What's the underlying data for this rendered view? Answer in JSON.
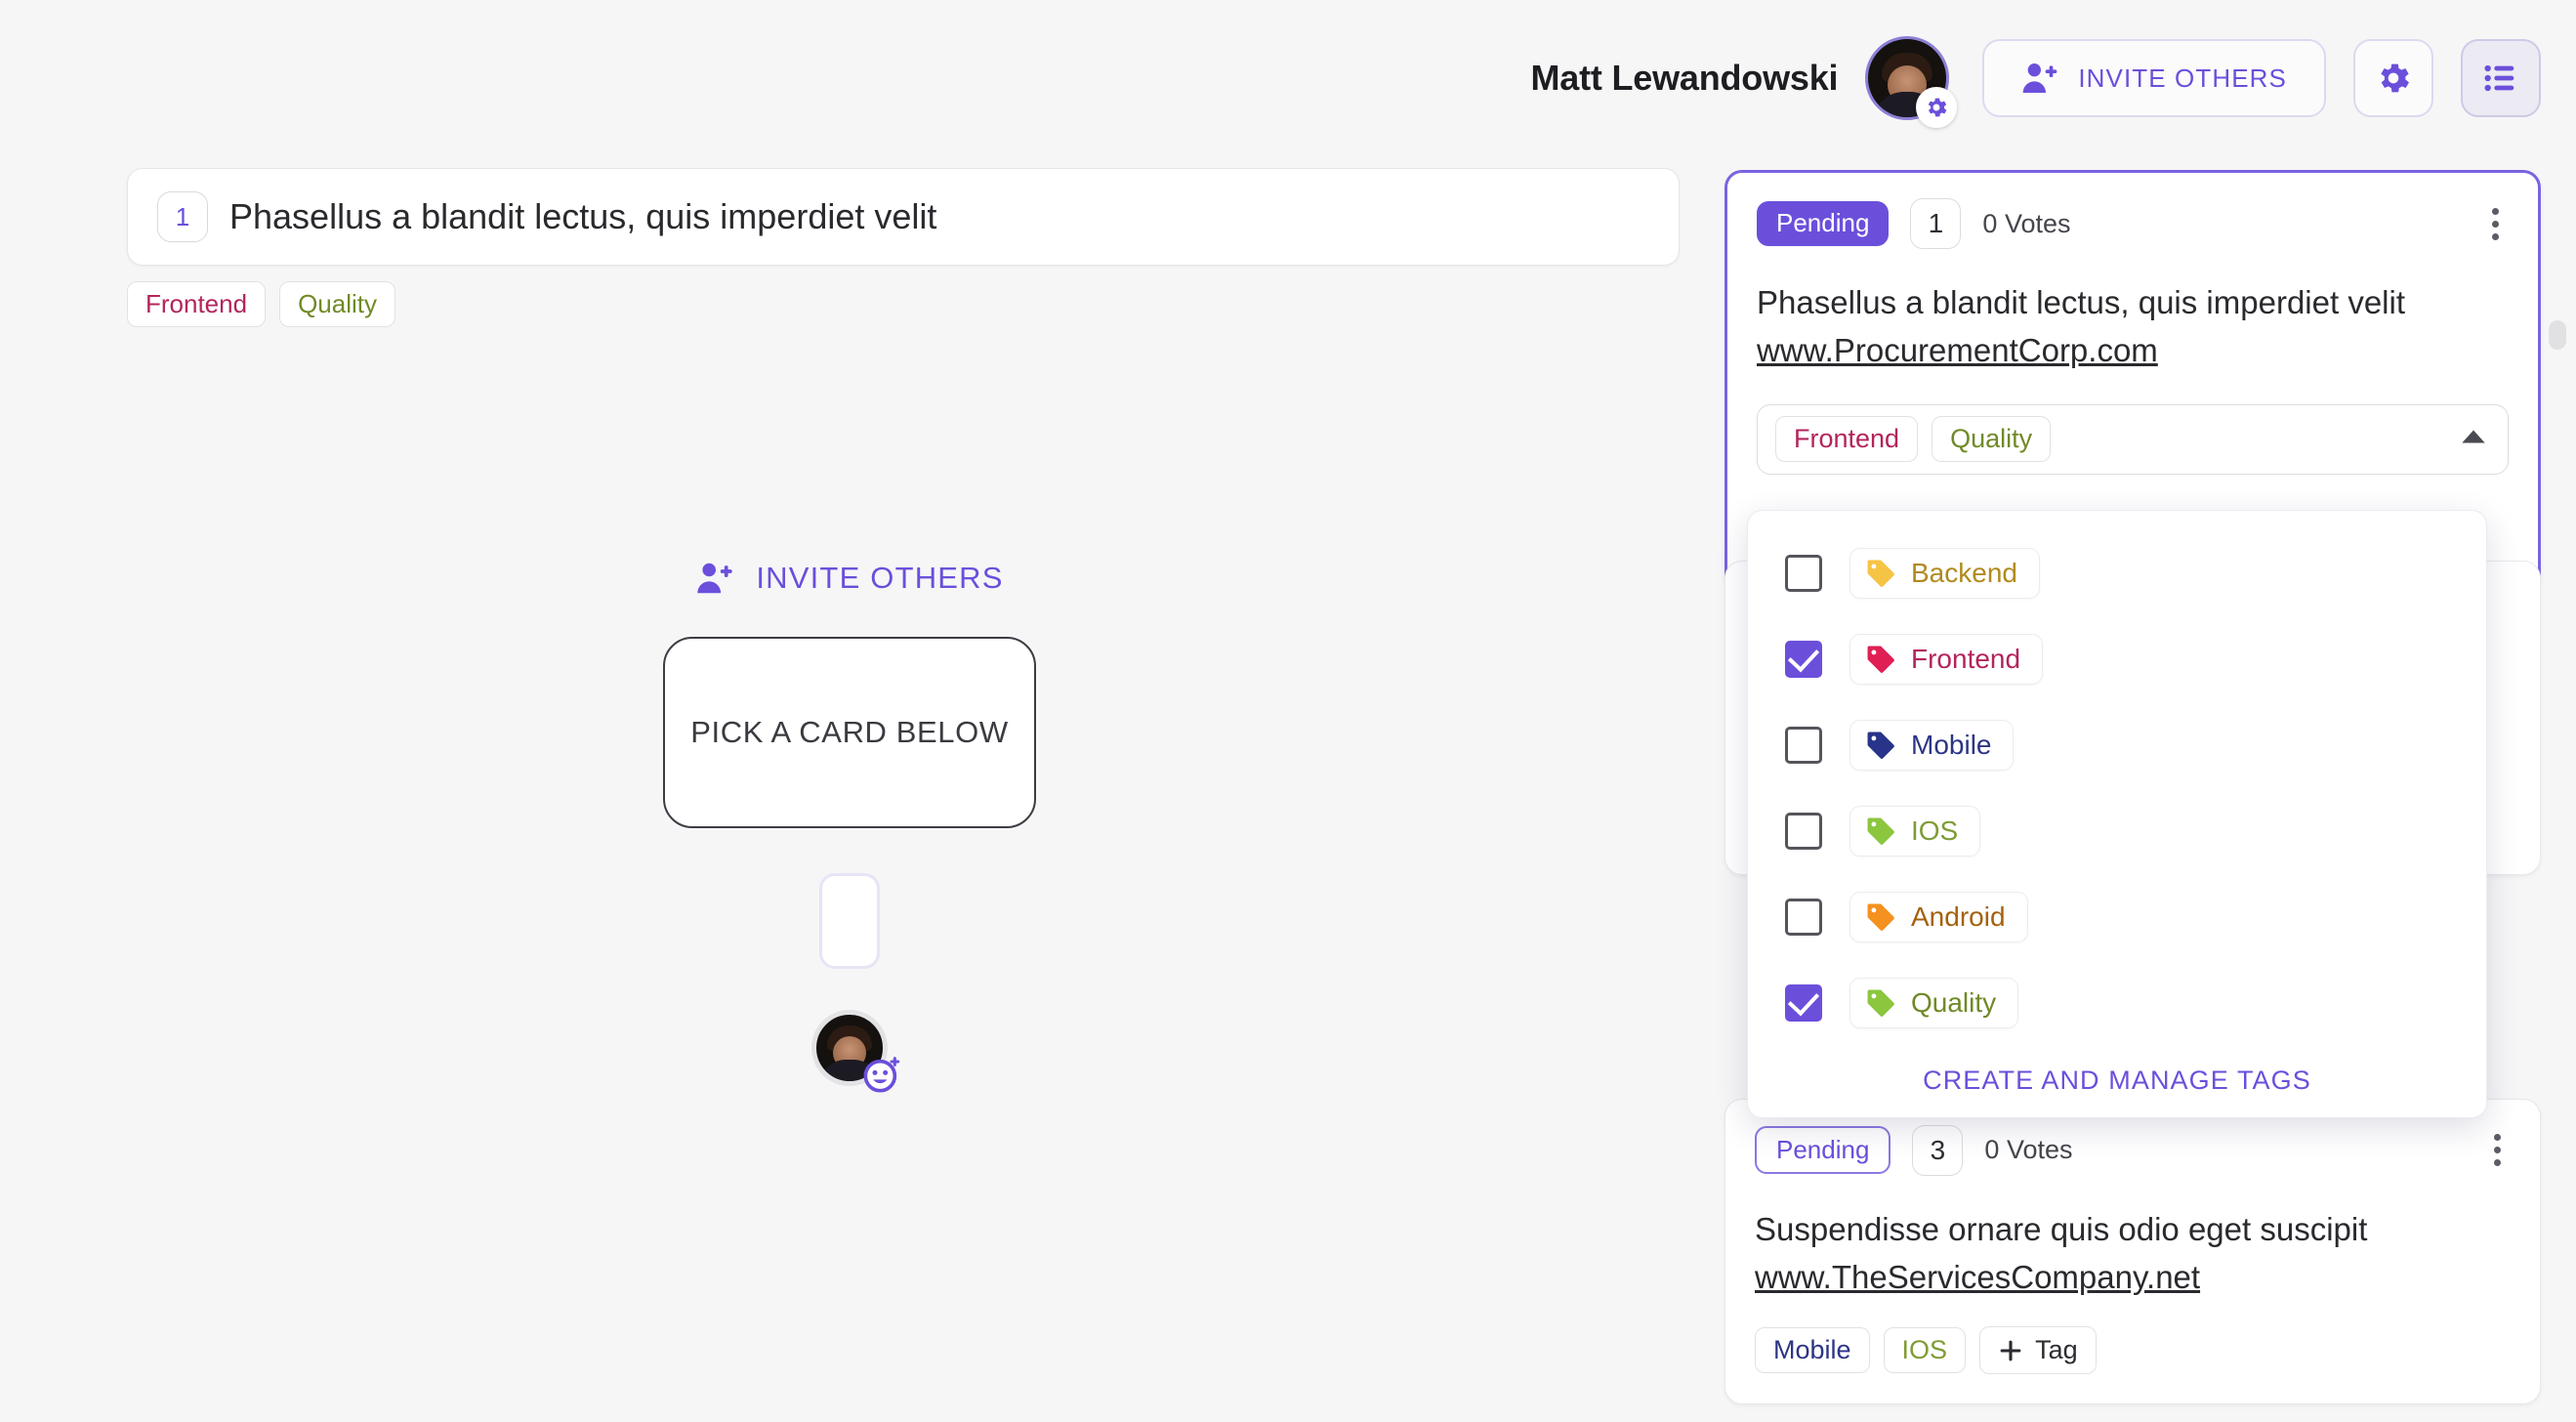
{
  "header": {
    "user_name": "Matt Lewandowski",
    "avatar_name": "user-avatar",
    "invite_label": "INVITE OTHERS",
    "settings_icon": "gear-icon",
    "list_icon": "list-view-icon",
    "accent_color": "#6b4fdb"
  },
  "main": {
    "active_card": {
      "number": "1",
      "title": "Phasellus a blandit lectus, quis imperdiet velit",
      "tags": [
        {
          "label": "Frontend",
          "color": "#b3245c"
        },
        {
          "label": "Quality",
          "color": "#6f8a26"
        }
      ]
    },
    "invite_inline_label": "INVITE OTHERS",
    "pick_card_label": "PICK A CARD BELOW",
    "seat_avatar": "player-avatar",
    "seat_badge_icon": "add-reaction-icon"
  },
  "panel": {
    "cards": [
      {
        "status": "Pending",
        "status_style": "filled",
        "number": "1",
        "votes": "0 Votes",
        "title": "Phasellus a blandit lectus, quis imperdiet velit",
        "url": "www.ProcurementCorp.com",
        "selected_tags": [
          {
            "label": "Frontend",
            "color": "#b3245c"
          },
          {
            "label": "Quality",
            "color": "#6f8a26"
          }
        ]
      },
      {
        "status": "Pending",
        "status_style": "outline",
        "number": "3",
        "votes": "0 Votes",
        "title": "Suspendisse ornare quis odio eget suscipit",
        "url": "www.TheServicesCompany.net",
        "selected_tags": [
          {
            "label": "Mobile",
            "color": "#2c3585"
          },
          {
            "label": "IOS",
            "color": "#7f9c35"
          }
        ],
        "add_tag_label": "Tag",
        "add_tag_icon": "plus-icon"
      }
    ]
  },
  "dropdown": {
    "caret_icon": "chevron-up-icon",
    "options": [
      {
        "label": "Backend",
        "checked": false,
        "color": "#b08a1e",
        "tag_color": "#f6c445"
      },
      {
        "label": "Frontend",
        "checked": true,
        "color": "#b3245c",
        "tag_color": "#e01f55"
      },
      {
        "label": "Mobile",
        "checked": false,
        "color": "#2c3585",
        "tag_color": "#27348a"
      },
      {
        "label": "IOS",
        "checked": false,
        "color": "#7f9c35",
        "tag_color": "#8cc63e"
      },
      {
        "label": "Android",
        "checked": false,
        "color": "#a4620c",
        "tag_color": "#f5911e"
      },
      {
        "label": "Quality",
        "checked": false,
        "color": "#6f8a26",
        "tag_color": "#8cc63e"
      }
    ],
    "quality_checked": true,
    "footer_label": "CREATE AND MANAGE TAGS"
  }
}
